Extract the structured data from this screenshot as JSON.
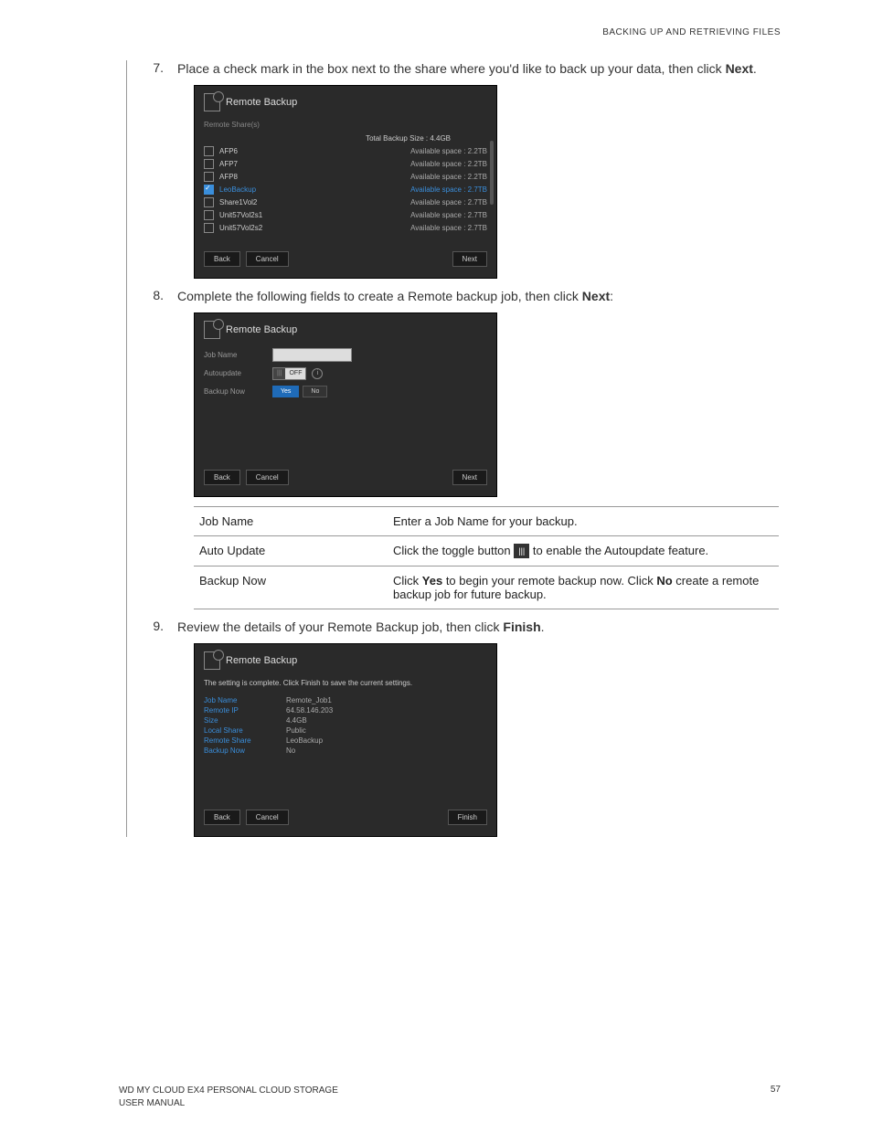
{
  "header": "BACKING UP AND RETRIEVING FILES",
  "steps": {
    "s7": {
      "num": "7.",
      "text_a": "Place a check mark in the box next to the share where you'd like to back up your data, then click ",
      "text_b": "Next",
      "text_c": "."
    },
    "s8": {
      "num": "8.",
      "text_a": "Complete the following fields to create a Remote backup job, then click ",
      "text_b": "Next",
      "text_c": ":"
    },
    "s9": {
      "num": "9.",
      "text_a": "Review the details of your Remote Backup job, then click ",
      "text_b": "Finish",
      "text_c": "."
    }
  },
  "panel_title": "Remote Backup",
  "panel1": {
    "sub": "Remote Share(s)",
    "total": "Total Backup Size : 4.4GB",
    "shares": [
      {
        "name": "AFP6",
        "space": "Available space : 2.2TB",
        "checked": false
      },
      {
        "name": "AFP7",
        "space": "Available space : 2.2TB",
        "checked": false
      },
      {
        "name": "AFP8",
        "space": "Available space : 2.2TB",
        "checked": false
      },
      {
        "name": "LeoBackup",
        "space": "Available space : 2.7TB",
        "checked": true
      },
      {
        "name": "Share1Vol2",
        "space": "Available space : 2.7TB",
        "checked": false
      },
      {
        "name": "Unit57Vol2s1",
        "space": "Available space : 2.7TB",
        "checked": false
      },
      {
        "name": "Unit57Vol2s2",
        "space": "Available space : 2.7TB",
        "checked": false
      }
    ],
    "back": "Back",
    "cancel": "Cancel",
    "next": "Next"
  },
  "panel2": {
    "job_label": "Job Name",
    "auto_label": "Autoupdate",
    "toggle_off": "OFF",
    "backup_now_label": "Backup Now",
    "yes": "Yes",
    "no": "No",
    "back": "Back",
    "cancel": "Cancel",
    "next": "Next"
  },
  "desc_table": {
    "r1": {
      "label": "Job Name",
      "text": "Enter a Job Name for your backup."
    },
    "r2": {
      "label": "Auto Update",
      "pre": "Click the toggle button ",
      "post": " to enable the Autoupdate feature."
    },
    "r3": {
      "label": "Backup Now",
      "a": "Click ",
      "yes": "Yes",
      "b": " to begin your remote backup now. Click ",
      "no": "No",
      "c": " create a remote backup job for future backup."
    }
  },
  "panel3": {
    "msg": "The setting is complete. Click Finish to save the current settings.",
    "rows": [
      {
        "label": "Job Name",
        "val": "Remote_Job1"
      },
      {
        "label": "Remote IP",
        "val": "64.58.146.203"
      },
      {
        "label": "Size",
        "val": "4.4GB"
      },
      {
        "label": "Local Share",
        "val": "Public"
      },
      {
        "label": "Remote Share",
        "val": "LeoBackup"
      },
      {
        "label": "Backup Now",
        "val": "No"
      }
    ],
    "back": "Back",
    "cancel": "Cancel",
    "finish": "Finish"
  },
  "footer": {
    "line1": "WD MY CLOUD EX4 PERSONAL CLOUD STORAGE",
    "line2": "USER MANUAL",
    "page": "57"
  }
}
